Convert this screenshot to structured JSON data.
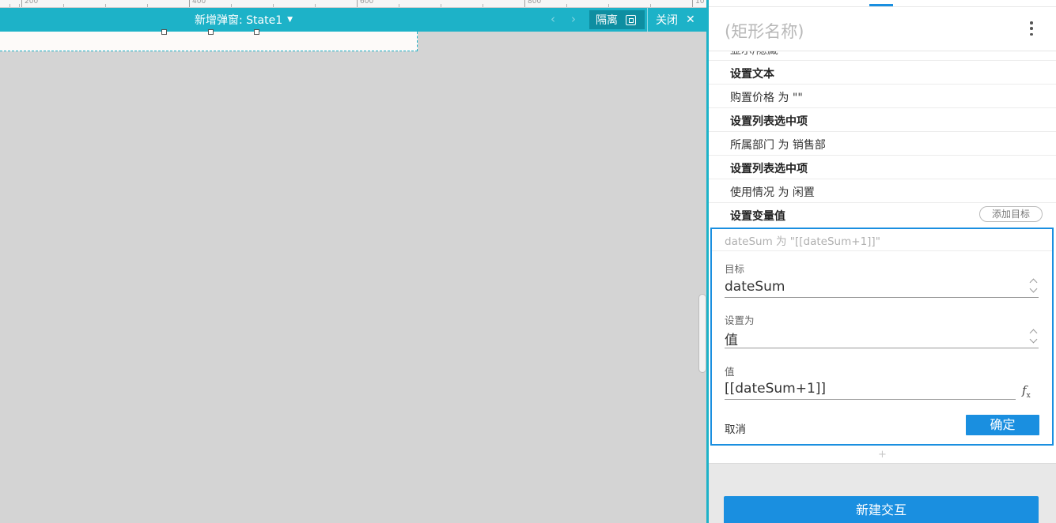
{
  "ruler": {
    "labels": [
      "200",
      "400",
      "600",
      "800",
      "10"
    ]
  },
  "topbar": {
    "title": "新增弹窗: State1",
    "isolate_label": "隔离",
    "close_label": "关闭"
  },
  "panel": {
    "title": "(矩形名称)",
    "rows": [
      {
        "text": "显示/隐藏",
        "kind": "cut"
      },
      {
        "text": "设置文本",
        "kind": "head"
      },
      {
        "text": "购置价格 为 \"\"",
        "kind": "item"
      },
      {
        "text": "设置列表选中项",
        "kind": "head"
      },
      {
        "text": "所属部门 为 销售部",
        "kind": "item"
      },
      {
        "text": "设置列表选中项",
        "kind": "head"
      },
      {
        "text": "使用情况 为 闲置",
        "kind": "item"
      },
      {
        "text": "设置变量值",
        "kind": "head"
      }
    ],
    "add_target_label": "添加目标",
    "editor": {
      "summary": "dateSum 为 \"[[dateSum+1]]\"",
      "target_label": "目标",
      "target_value": "dateSum",
      "setas_label": "设置为",
      "setas_value": "值",
      "value_label": "值",
      "value_value": "[[dateSum+1]]",
      "cancel_label": "取消",
      "ok_label": "确定"
    },
    "plus_symbol": "+",
    "new_interaction_label": "新建交互"
  },
  "colors": {
    "topbar": "#1db2c8",
    "accent": "#1a8fe0",
    "canvas": "#d4d4d4"
  },
  "icons": [
    "dropdown-caret-icon",
    "chevron-left-icon",
    "chevron-right-icon",
    "fullscreen-icon",
    "close-icon",
    "more-vertical-icon",
    "stepper-icon",
    "fx-icon"
  ]
}
